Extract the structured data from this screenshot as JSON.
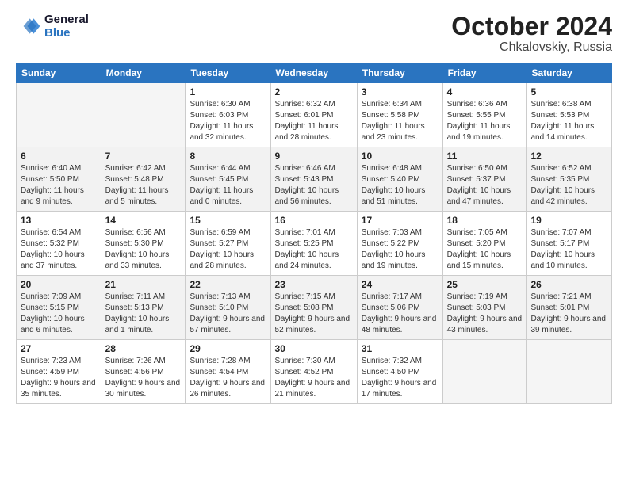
{
  "header": {
    "logo_line1": "General",
    "logo_line2": "Blue",
    "month": "October 2024",
    "location": "Chkalovskiy, Russia"
  },
  "weekdays": [
    "Sunday",
    "Monday",
    "Tuesday",
    "Wednesday",
    "Thursday",
    "Friday",
    "Saturday"
  ],
  "rows": [
    [
      {
        "day": "",
        "empty": true
      },
      {
        "day": "",
        "empty": true
      },
      {
        "day": "1",
        "sunrise": "Sunrise: 6:30 AM",
        "sunset": "Sunset: 6:03 PM",
        "daylight": "Daylight: 11 hours and 32 minutes."
      },
      {
        "day": "2",
        "sunrise": "Sunrise: 6:32 AM",
        "sunset": "Sunset: 6:01 PM",
        "daylight": "Daylight: 11 hours and 28 minutes."
      },
      {
        "day": "3",
        "sunrise": "Sunrise: 6:34 AM",
        "sunset": "Sunset: 5:58 PM",
        "daylight": "Daylight: 11 hours and 23 minutes."
      },
      {
        "day": "4",
        "sunrise": "Sunrise: 6:36 AM",
        "sunset": "Sunset: 5:55 PM",
        "daylight": "Daylight: 11 hours and 19 minutes."
      },
      {
        "day": "5",
        "sunrise": "Sunrise: 6:38 AM",
        "sunset": "Sunset: 5:53 PM",
        "daylight": "Daylight: 11 hours and 14 minutes."
      }
    ],
    [
      {
        "day": "6",
        "sunrise": "Sunrise: 6:40 AM",
        "sunset": "Sunset: 5:50 PM",
        "daylight": "Daylight: 11 hours and 9 minutes."
      },
      {
        "day": "7",
        "sunrise": "Sunrise: 6:42 AM",
        "sunset": "Sunset: 5:48 PM",
        "daylight": "Daylight: 11 hours and 5 minutes."
      },
      {
        "day": "8",
        "sunrise": "Sunrise: 6:44 AM",
        "sunset": "Sunset: 5:45 PM",
        "daylight": "Daylight: 11 hours and 0 minutes."
      },
      {
        "day": "9",
        "sunrise": "Sunrise: 6:46 AM",
        "sunset": "Sunset: 5:43 PM",
        "daylight": "Daylight: 10 hours and 56 minutes."
      },
      {
        "day": "10",
        "sunrise": "Sunrise: 6:48 AM",
        "sunset": "Sunset: 5:40 PM",
        "daylight": "Daylight: 10 hours and 51 minutes."
      },
      {
        "day": "11",
        "sunrise": "Sunrise: 6:50 AM",
        "sunset": "Sunset: 5:37 PM",
        "daylight": "Daylight: 10 hours and 47 minutes."
      },
      {
        "day": "12",
        "sunrise": "Sunrise: 6:52 AM",
        "sunset": "Sunset: 5:35 PM",
        "daylight": "Daylight: 10 hours and 42 minutes."
      }
    ],
    [
      {
        "day": "13",
        "sunrise": "Sunrise: 6:54 AM",
        "sunset": "Sunset: 5:32 PM",
        "daylight": "Daylight: 10 hours and 37 minutes."
      },
      {
        "day": "14",
        "sunrise": "Sunrise: 6:56 AM",
        "sunset": "Sunset: 5:30 PM",
        "daylight": "Daylight: 10 hours and 33 minutes."
      },
      {
        "day": "15",
        "sunrise": "Sunrise: 6:59 AM",
        "sunset": "Sunset: 5:27 PM",
        "daylight": "Daylight: 10 hours and 28 minutes."
      },
      {
        "day": "16",
        "sunrise": "Sunrise: 7:01 AM",
        "sunset": "Sunset: 5:25 PM",
        "daylight": "Daylight: 10 hours and 24 minutes."
      },
      {
        "day": "17",
        "sunrise": "Sunrise: 7:03 AM",
        "sunset": "Sunset: 5:22 PM",
        "daylight": "Daylight: 10 hours and 19 minutes."
      },
      {
        "day": "18",
        "sunrise": "Sunrise: 7:05 AM",
        "sunset": "Sunset: 5:20 PM",
        "daylight": "Daylight: 10 hours and 15 minutes."
      },
      {
        "day": "19",
        "sunrise": "Sunrise: 7:07 AM",
        "sunset": "Sunset: 5:17 PM",
        "daylight": "Daylight: 10 hours and 10 minutes."
      }
    ],
    [
      {
        "day": "20",
        "sunrise": "Sunrise: 7:09 AM",
        "sunset": "Sunset: 5:15 PM",
        "daylight": "Daylight: 10 hours and 6 minutes."
      },
      {
        "day": "21",
        "sunrise": "Sunrise: 7:11 AM",
        "sunset": "Sunset: 5:13 PM",
        "daylight": "Daylight: 10 hours and 1 minute."
      },
      {
        "day": "22",
        "sunrise": "Sunrise: 7:13 AM",
        "sunset": "Sunset: 5:10 PM",
        "daylight": "Daylight: 9 hours and 57 minutes."
      },
      {
        "day": "23",
        "sunrise": "Sunrise: 7:15 AM",
        "sunset": "Sunset: 5:08 PM",
        "daylight": "Daylight: 9 hours and 52 minutes."
      },
      {
        "day": "24",
        "sunrise": "Sunrise: 7:17 AM",
        "sunset": "Sunset: 5:06 PM",
        "daylight": "Daylight: 9 hours and 48 minutes."
      },
      {
        "day": "25",
        "sunrise": "Sunrise: 7:19 AM",
        "sunset": "Sunset: 5:03 PM",
        "daylight": "Daylight: 9 hours and 43 minutes."
      },
      {
        "day": "26",
        "sunrise": "Sunrise: 7:21 AM",
        "sunset": "Sunset: 5:01 PM",
        "daylight": "Daylight: 9 hours and 39 minutes."
      }
    ],
    [
      {
        "day": "27",
        "sunrise": "Sunrise: 7:23 AM",
        "sunset": "Sunset: 4:59 PM",
        "daylight": "Daylight: 9 hours and 35 minutes."
      },
      {
        "day": "28",
        "sunrise": "Sunrise: 7:26 AM",
        "sunset": "Sunset: 4:56 PM",
        "daylight": "Daylight: 9 hours and 30 minutes."
      },
      {
        "day": "29",
        "sunrise": "Sunrise: 7:28 AM",
        "sunset": "Sunset: 4:54 PM",
        "daylight": "Daylight: 9 hours and 26 minutes."
      },
      {
        "day": "30",
        "sunrise": "Sunrise: 7:30 AM",
        "sunset": "Sunset: 4:52 PM",
        "daylight": "Daylight: 9 hours and 21 minutes."
      },
      {
        "day": "31",
        "sunrise": "Sunrise: 7:32 AM",
        "sunset": "Sunset: 4:50 PM",
        "daylight": "Daylight: 9 hours and 17 minutes."
      },
      {
        "day": "",
        "empty": true
      },
      {
        "day": "",
        "empty": true
      }
    ]
  ]
}
